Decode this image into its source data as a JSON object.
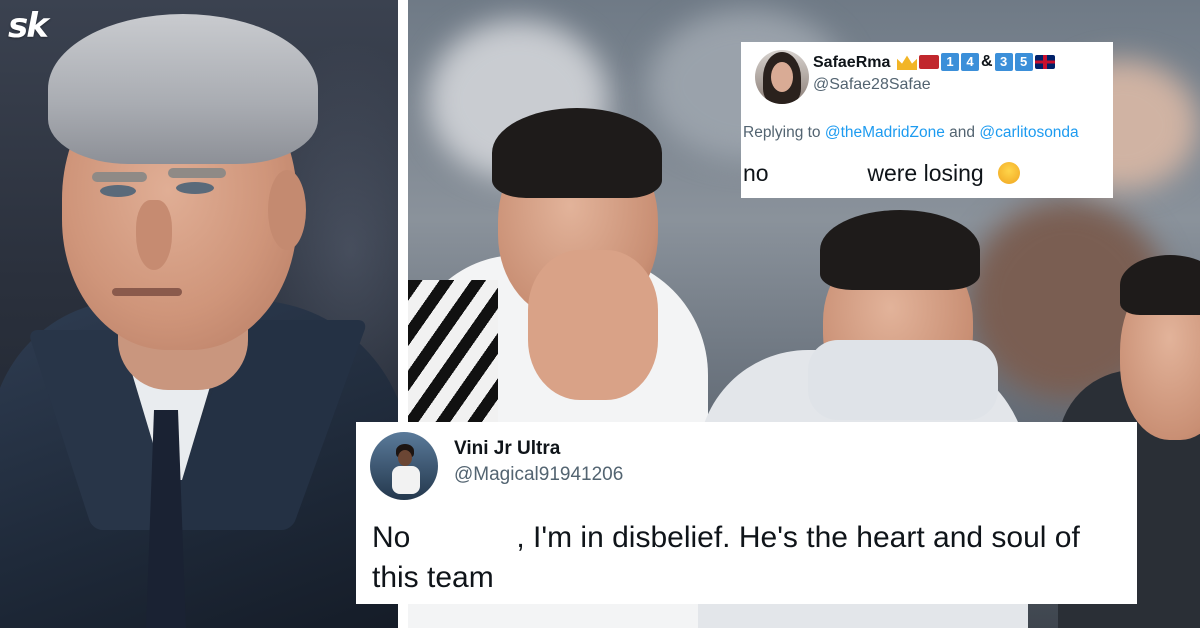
{
  "brand": {
    "logo_text": "sk"
  },
  "tweets": [
    {
      "display_name": "SafaeRma",
      "badges": [
        "1",
        "4",
        "&",
        "3",
        "5"
      ],
      "handle": "@Safae28Safae",
      "reply_prefix": "Replying to",
      "reply_mention_1": "@theMadridZone",
      "reply_and": "and",
      "reply_mention_2": "@carlitosonda",
      "text_start": "no",
      "text_end": "were losing"
    },
    {
      "display_name": "Vini Jr Ultra",
      "handle": "@Magical91941206",
      "text_start": "No",
      "text_end": ", I'm in disbelief. He's the heart and soul of this team"
    }
  ],
  "colors": {
    "link": "#1d9bf0",
    "handle": "#536471",
    "text": "#0f1419"
  }
}
